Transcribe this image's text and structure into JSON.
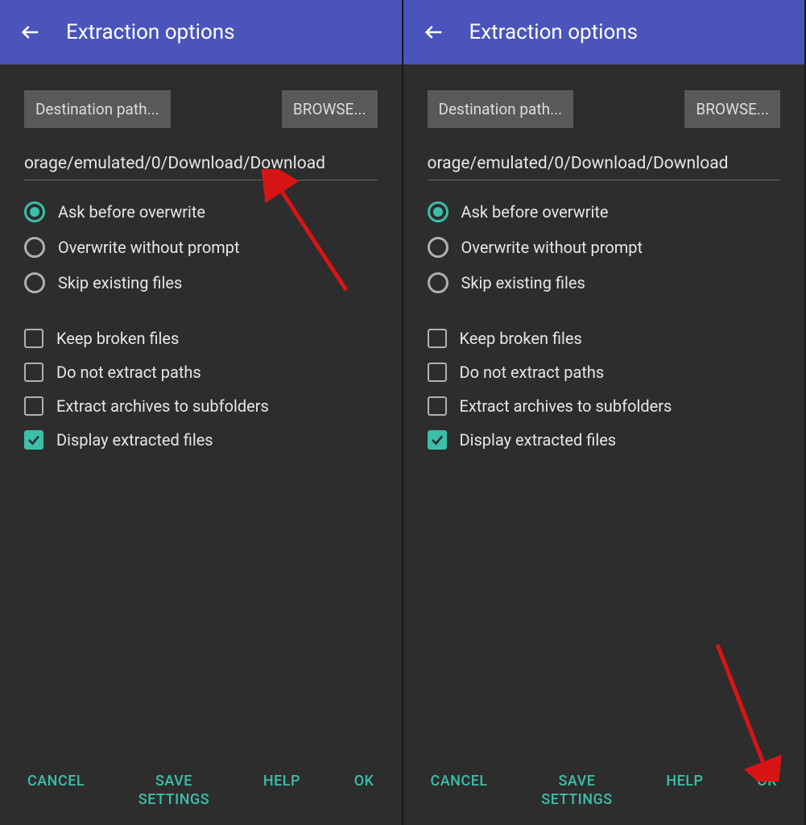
{
  "left": {
    "title": "Extraction options",
    "destination_btn": "Destination path...",
    "browse_btn": "BROWSE...",
    "path_value": "orage/emulated/0/Download/Download",
    "radios": [
      {
        "label": "Ask before overwrite",
        "checked": true
      },
      {
        "label": "Overwrite without prompt",
        "checked": false
      },
      {
        "label": "Skip existing files",
        "checked": false
      }
    ],
    "checks": [
      {
        "label": "Keep broken files",
        "checked": false
      },
      {
        "label": "Do not extract paths",
        "checked": false
      },
      {
        "label": "Extract archives to subfolders",
        "checked": false
      },
      {
        "label": "Display extracted files",
        "checked": true
      }
    ],
    "buttons": {
      "cancel": "CANCEL",
      "save": "SAVE\nSETTINGS",
      "help": "HELP",
      "ok": "OK"
    }
  },
  "right": {
    "title": "Extraction options",
    "destination_btn": "Destination path...",
    "browse_btn": "BROWSE...",
    "path_value": "orage/emulated/0/Download/Download",
    "radios": [
      {
        "label": "Ask before overwrite",
        "checked": true
      },
      {
        "label": "Overwrite without prompt",
        "checked": false
      },
      {
        "label": "Skip existing files",
        "checked": false
      }
    ],
    "checks": [
      {
        "label": "Keep broken files",
        "checked": false
      },
      {
        "label": "Do not extract paths",
        "checked": false
      },
      {
        "label": "Extract archives to subfolders",
        "checked": false
      },
      {
        "label": "Display extracted files",
        "checked": true
      }
    ],
    "buttons": {
      "cancel": "CANCEL",
      "save": "SAVE\nSETTINGS",
      "help": "HELP",
      "ok": "OK"
    }
  }
}
